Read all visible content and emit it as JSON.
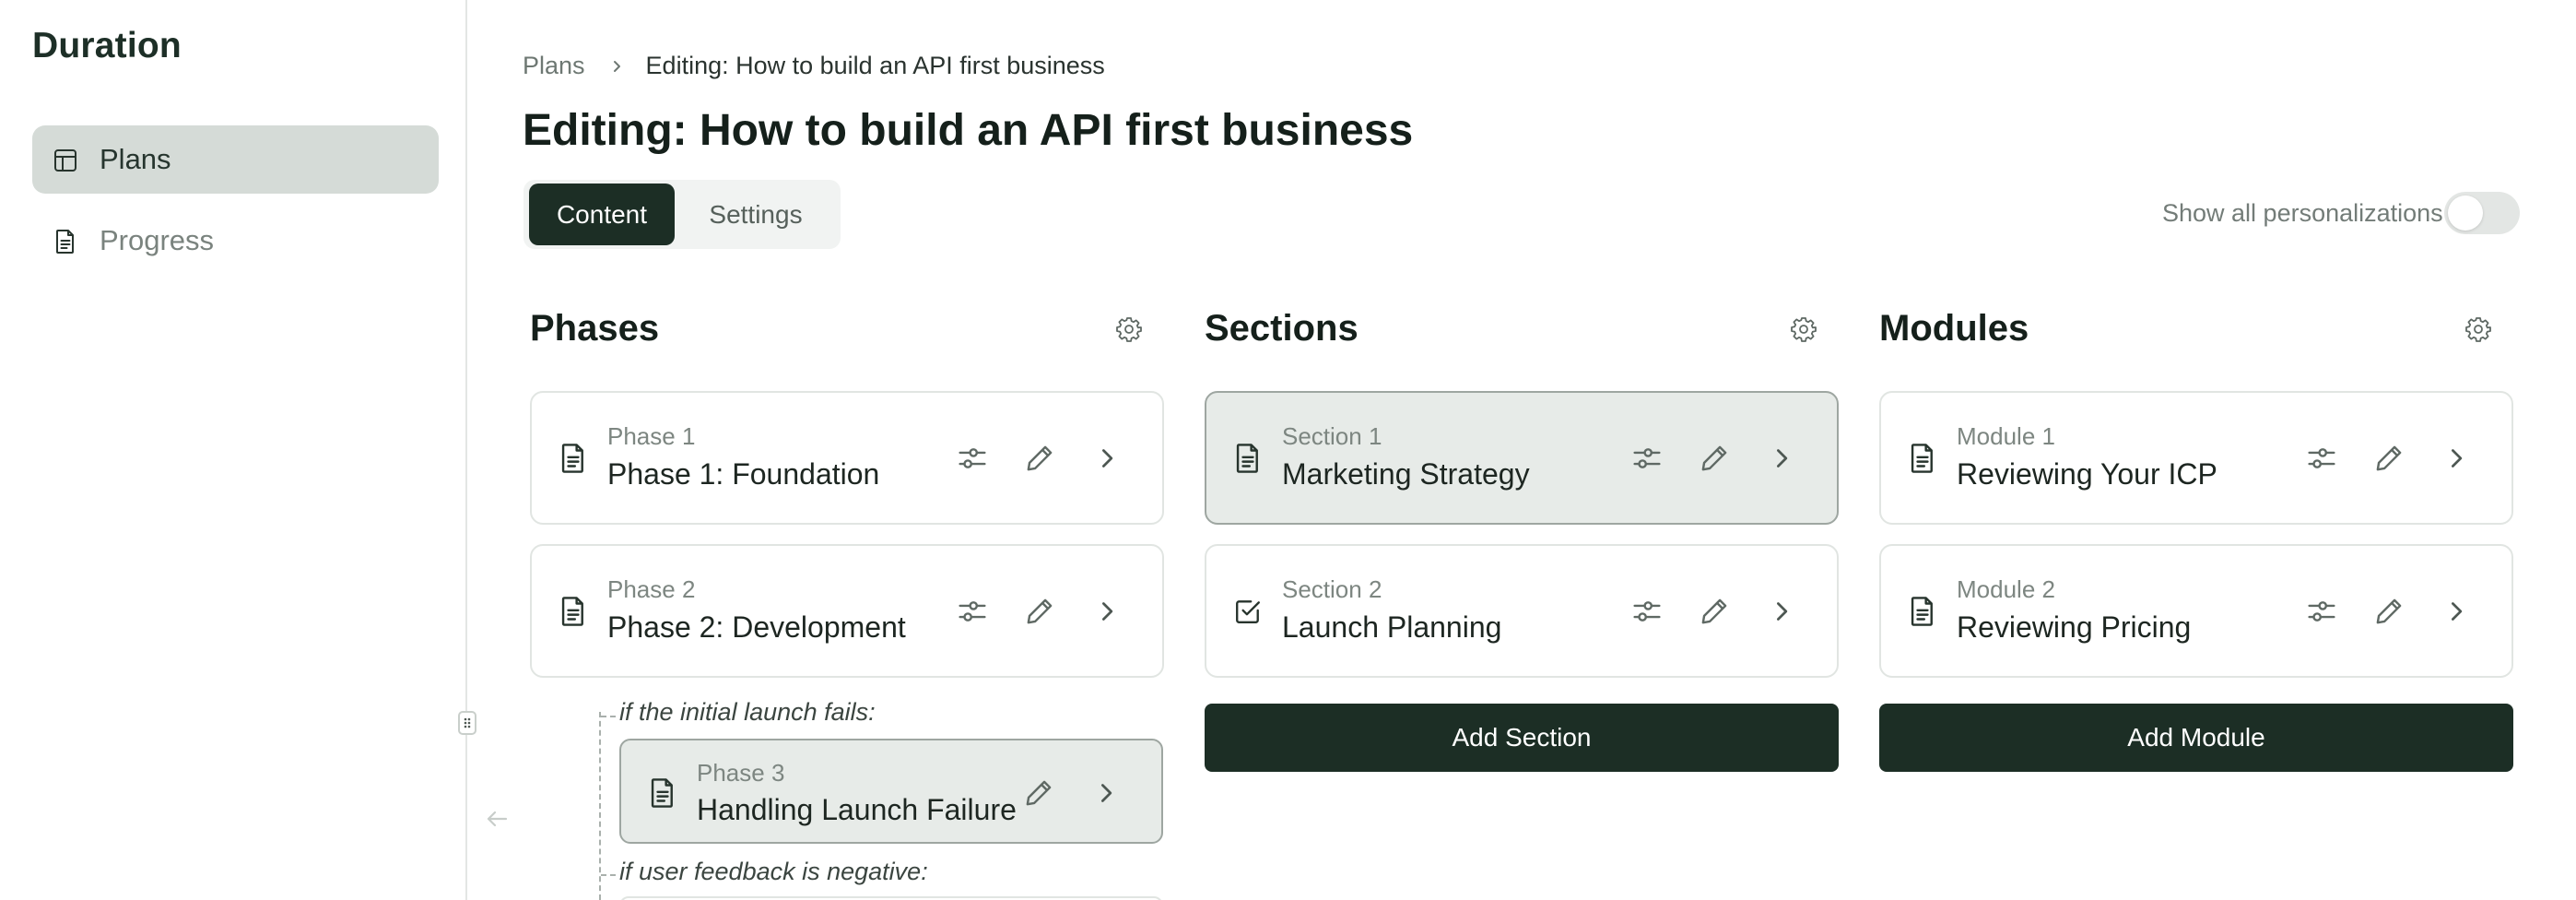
{
  "app": {
    "title": "Duration"
  },
  "sidebar": {
    "items": [
      {
        "label": "Plans",
        "icon": "layout-icon",
        "active": true
      },
      {
        "label": "Progress",
        "icon": "document-icon",
        "active": false
      }
    ]
  },
  "breadcrumb": {
    "parent": "Plans",
    "current": "Editing: How to build an API first business"
  },
  "page": {
    "title": "Editing: How to build an API first business"
  },
  "tabs": [
    {
      "label": "Content",
      "active": true
    },
    {
      "label": "Settings",
      "active": false
    }
  ],
  "personalizations": {
    "label": "Show all personalizations",
    "enabled": false
  },
  "columns": {
    "phases": {
      "title": "Phases",
      "items": [
        {
          "label": "Phase 1",
          "name": "Phase 1: Foundation"
        },
        {
          "label": "Phase 2",
          "name": "Phase 2: Development"
        }
      ],
      "branches": [
        {
          "condition": "if the initial launch fails:",
          "label": "Phase 3",
          "name": "Handling Launch Failure"
        },
        {
          "condition": "if user feedback is negative:"
        }
      ]
    },
    "sections": {
      "title": "Sections",
      "items": [
        {
          "label": "Section 1",
          "name": "Marketing Strategy",
          "selected": true
        },
        {
          "label": "Section 2",
          "name": "Launch Planning",
          "icon": "checkbox-icon"
        }
      ],
      "add_label": "Add Section"
    },
    "modules": {
      "title": "Modules",
      "items": [
        {
          "label": "Module 1",
          "name": "Reviewing Your ICP"
        },
        {
          "label": "Module 2",
          "name": "Reviewing Pricing"
        }
      ],
      "add_label": "Add Module"
    }
  },
  "colors": {
    "accent": "#1c2e25",
    "selected_bg": "#e7ebe8",
    "nav_active_bg": "#d5dbd7"
  }
}
